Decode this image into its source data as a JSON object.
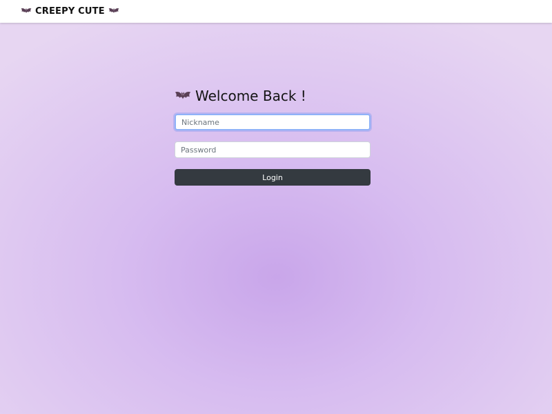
{
  "navbar": {
    "brand": "CREEPY CUTE",
    "brand_icon_left": "bat-icon",
    "brand_icon_right": "bat-icon"
  },
  "login": {
    "heading": "Welcome Back !",
    "heading_icon": "bat-icon",
    "nickname_placeholder": "Nickname",
    "nickname_value": "",
    "password_placeholder": "Password",
    "password_value": "",
    "submit_label": "Login"
  },
  "colors": {
    "background_center": "#c9a6ea",
    "background_edge": "#e7d6f2",
    "button": "#343a40",
    "focus_ring": "#8fb2f8",
    "bat": "#5a4056"
  }
}
